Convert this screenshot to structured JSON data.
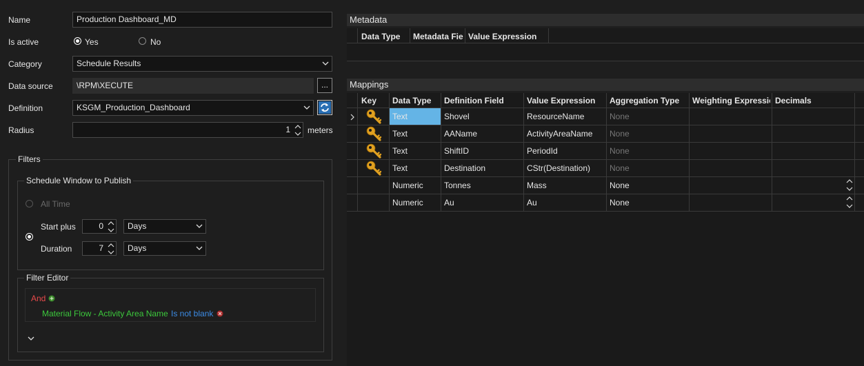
{
  "form": {
    "name_label": "Name",
    "name_value": "Production Dashboard_MD",
    "active_label": "Is active",
    "active_yes": "Yes",
    "active_no": "No",
    "category_label": "Category",
    "category_value": "Schedule Results",
    "datasource_label": "Data source",
    "datasource_value": "\\RPM\\XECUTE",
    "browse_label": "...",
    "definition_label": "Definition",
    "definition_value": "KSGM_Production_Dashboard",
    "radius_label": "Radius",
    "radius_value": "1",
    "radius_unit": "meters"
  },
  "filters": {
    "title": "Filters",
    "schedule_window": {
      "title": "Schedule Window to Publish",
      "all_time": "All Time",
      "start_plus_label": "Start plus",
      "start_plus_value": "0",
      "start_plus_unit": "Days",
      "duration_label": "Duration",
      "duration_value": "7",
      "duration_unit": "Days"
    },
    "filter_editor": {
      "title": "Filter Editor",
      "operator": "And",
      "field": "Material Flow - Activity Area Name",
      "condition": "Is not blank"
    }
  },
  "metadata": {
    "title": "Metadata",
    "columns": [
      "Data Type",
      "Metadata Fie",
      "Value Expression"
    ]
  },
  "mappings": {
    "title": "Mappings",
    "columns": [
      "Key",
      "Data Type",
      "Definition Field",
      "Value Expression",
      "Aggregation Type",
      "Weighting Expressic",
      "Decimals"
    ],
    "rows": [
      {
        "key": true,
        "data_type": "Text",
        "definition_field": "Shovel",
        "value_expression": "ResourceName",
        "aggregation": "None",
        "aggregation_muted": true,
        "selected": true
      },
      {
        "key": true,
        "data_type": "Text",
        "definition_field": "AAName",
        "value_expression": "ActivityAreaName",
        "aggregation": "None",
        "aggregation_muted": true
      },
      {
        "key": true,
        "data_type": "Text",
        "definition_field": "ShiftID",
        "value_expression": "PeriodId",
        "aggregation": "None",
        "aggregation_muted": true
      },
      {
        "key": true,
        "data_type": "Text",
        "definition_field": "Destination",
        "value_expression": "CStr(Destination)",
        "aggregation": "None",
        "aggregation_muted": true
      },
      {
        "key": false,
        "data_type": "Numeric",
        "definition_field": "Tonnes",
        "value_expression": "Mass",
        "aggregation": "None",
        "aggregation_muted": false,
        "decimals_spinner": true
      },
      {
        "key": false,
        "data_type": "Numeric",
        "definition_field": "Au",
        "value_expression": "Au",
        "aggregation": "None",
        "aggregation_muted": false,
        "decimals_spinner": true
      }
    ]
  },
  "colors": {
    "background": "#1e1e1e",
    "selected_cell": "#64b4e6",
    "operator_red": "#e84a4a",
    "field_green": "#3cc83c",
    "condition_blue": "#3c8ce6",
    "key_gold": "#e0a020"
  },
  "icons": {
    "refresh": "refresh-icon",
    "add": "add-condition-icon",
    "remove": "remove-condition-icon",
    "key": "key-icon"
  }
}
